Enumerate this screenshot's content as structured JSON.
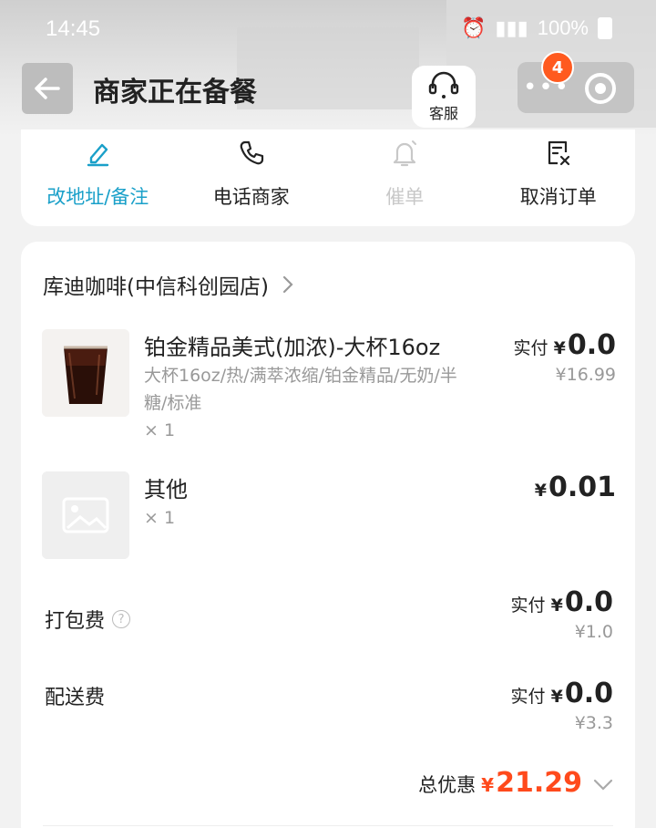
{
  "status_bar": {
    "time": "14:45",
    "battery": "100%"
  },
  "header": {
    "title": "商家正在备餐",
    "kefu_label": "客服",
    "badge_count": "4"
  },
  "actions": [
    {
      "label": "改地址/备注",
      "state": "active"
    },
    {
      "label": "电话商家",
      "state": "normal"
    },
    {
      "label": "催单",
      "state": "disabled"
    },
    {
      "label": "取消订单",
      "state": "normal"
    }
  ],
  "order": {
    "shop_name": "库迪咖啡(中信科创园店)",
    "items": [
      {
        "name": "铂金精品美式(加浓)-大杯16oz",
        "spec": "大杯16oz/热/满萃浓缩/铂金精品/无奶/半糖/标准",
        "qty": "× 1",
        "paid_label": "实付",
        "yen": "¥",
        "price": "0.0",
        "original": "¥16.99"
      },
      {
        "name": "其他",
        "qty": "× 1",
        "yen": "¥",
        "price": "0.01"
      }
    ],
    "fees": [
      {
        "label": "打包费",
        "paid_label": "实付",
        "yen": "¥",
        "price": "0.0",
        "original": "¥1.0"
      },
      {
        "label": "配送费",
        "paid_label": "实付",
        "yen": "¥",
        "price": "0.0",
        "original": "¥3.3"
      }
    ],
    "total": {
      "label": "总优惠",
      "yen": "¥",
      "amount": "21.29"
    }
  },
  "colors": {
    "accent": "#1aa0c9",
    "discount": "#ff4a1c",
    "badge": "#ff5a1f"
  }
}
